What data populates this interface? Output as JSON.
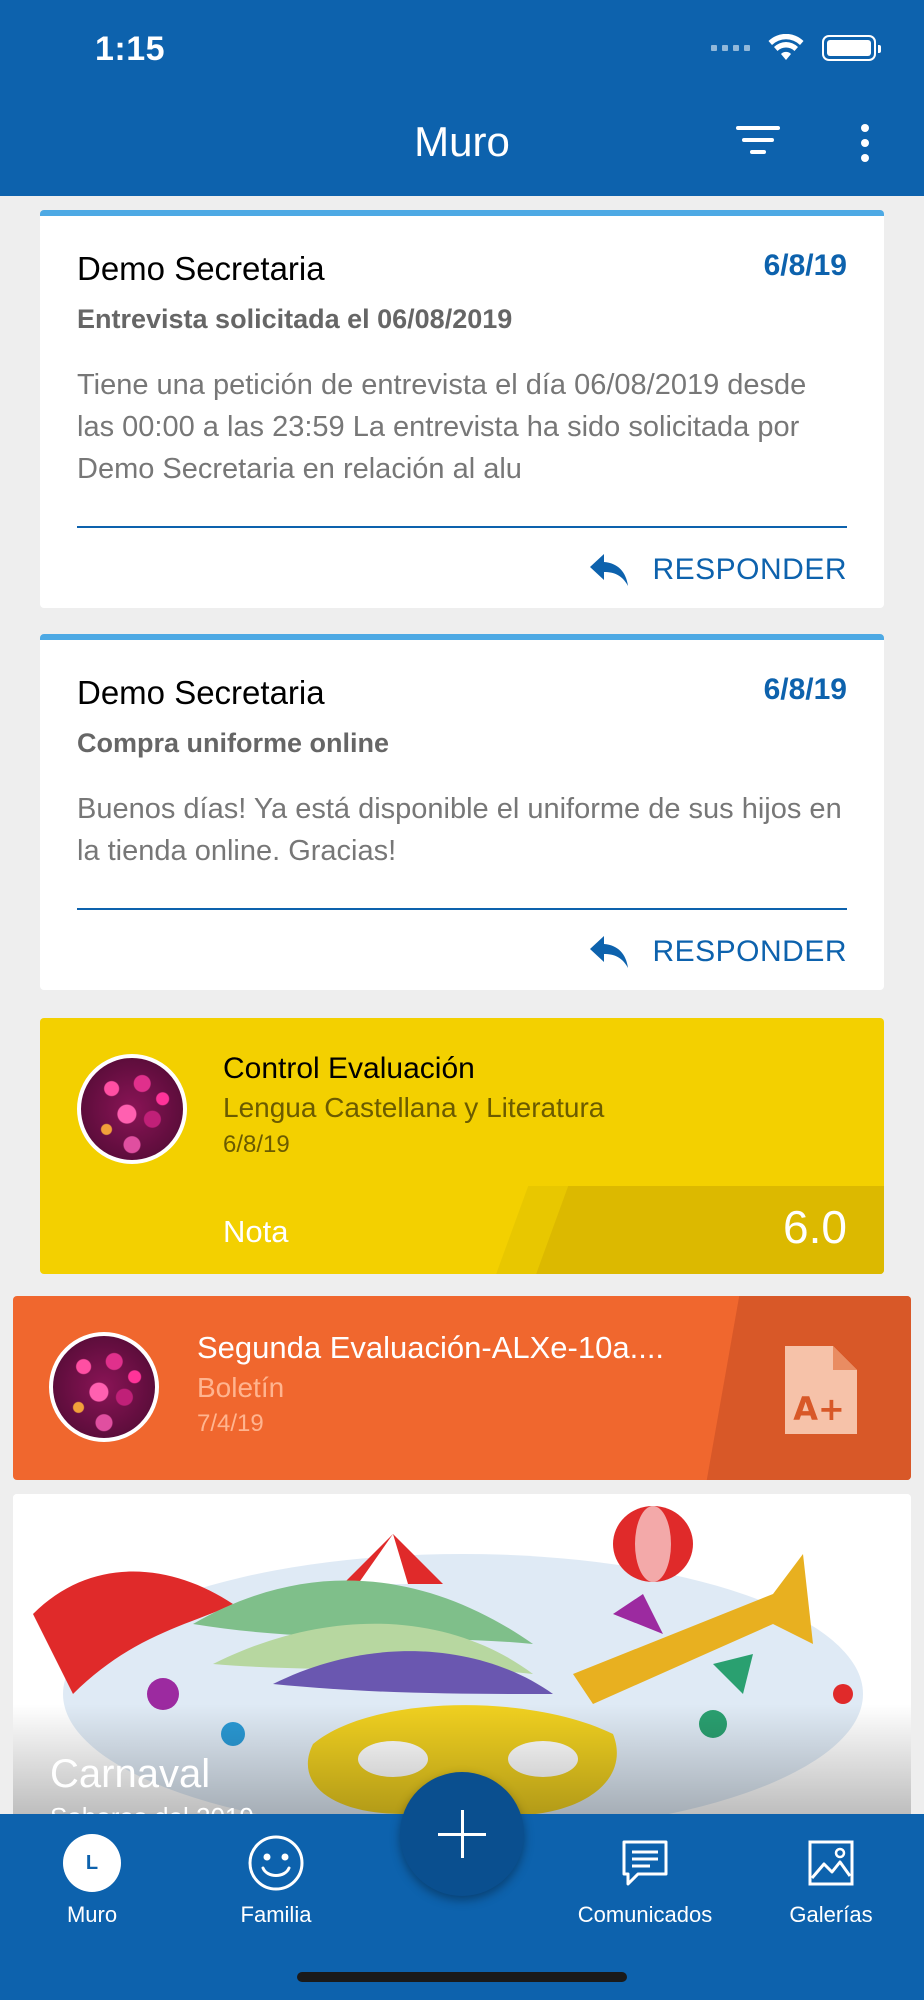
{
  "status_bar": {
    "time": "1:15"
  },
  "header": {
    "title": "Muro"
  },
  "messages": [
    {
      "sender": "Demo Secretaria",
      "date": "6/8/19",
      "subject": "Entrevista solicitada el 06/08/2019",
      "body": "Tiene una petición de entrevista el día 06/08/2019 desde las 00:00 a las 23:59 La entrevista ha sido solicitada por Demo Secretaria en relación al alu",
      "reply_label": "RESPONDER"
    },
    {
      "sender": "Demo Secretaria",
      "date": "6/8/19",
      "subject": "Compra uniforme online",
      "body": "Buenos días! Ya está disponible el uniforme de sus hijos en la tienda online. Gracias!",
      "reply_label": "RESPONDER"
    }
  ],
  "grade_card": {
    "title": "Control Evaluación",
    "subject": "Lengua Castellana y Literatura",
    "date": "6/8/19",
    "grade_label": "Nota",
    "grade_value": "6.0",
    "color": "#f3d000"
  },
  "report_card": {
    "title": "Segunda Evaluación-ALXe-10a....",
    "type": "Boletín",
    "date": "7/4/19",
    "icon": "report-grade-icon",
    "color": "#f0672e"
  },
  "gallery_card": {
    "title": "Carnaval",
    "subtitle": "Sabores del 2019"
  },
  "tabbar": {
    "items": [
      {
        "label": "Muro",
        "icon": "clock-icon",
        "avatar_letter": "L"
      },
      {
        "label": "Familia",
        "icon": "smiley-icon"
      },
      {
        "label": "Comunicados",
        "icon": "chat-icon"
      },
      {
        "label": "Galerías",
        "icon": "image-icon"
      }
    ],
    "fab_icon": "plus-icon"
  },
  "colors": {
    "primary": "#0d62ad",
    "accent": "#4da9e4"
  }
}
